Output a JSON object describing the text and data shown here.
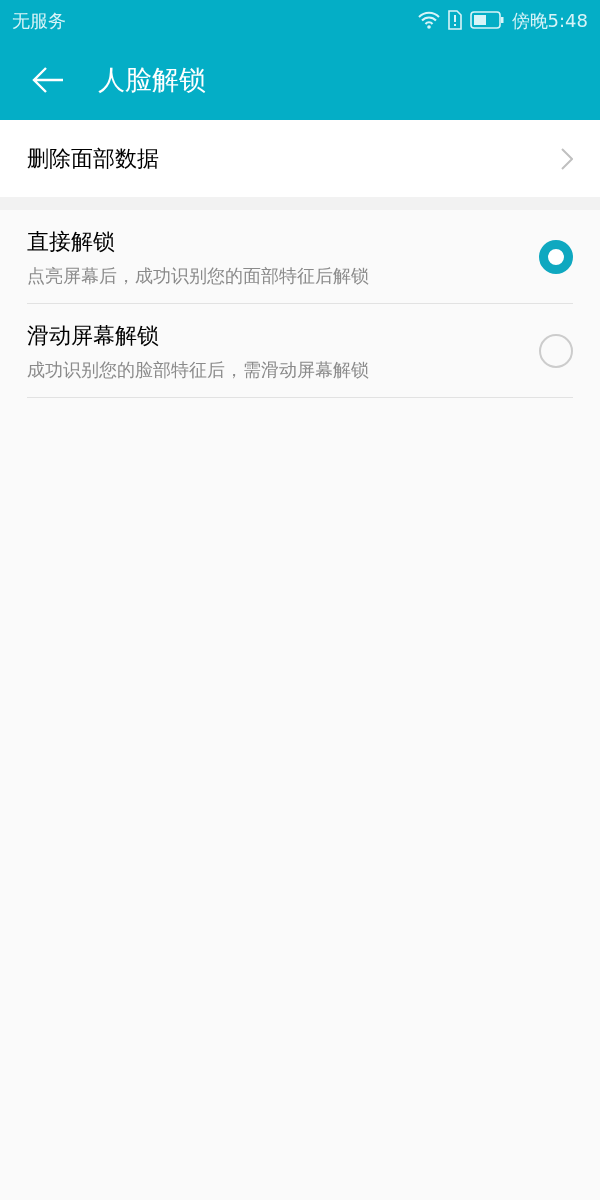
{
  "status_bar": {
    "carrier": "无服务",
    "time": "傍晚5:48"
  },
  "header": {
    "title": "人脸解锁"
  },
  "action": {
    "label": "删除面部数据"
  },
  "options": [
    {
      "title": "直接解锁",
      "description": "点亮屏幕后，成功识别您的面部特征后解锁",
      "selected": true
    },
    {
      "title": "滑动屏幕解锁",
      "description": "成功识别您的脸部特征后，需滑动屏幕解锁",
      "selected": false
    }
  ]
}
